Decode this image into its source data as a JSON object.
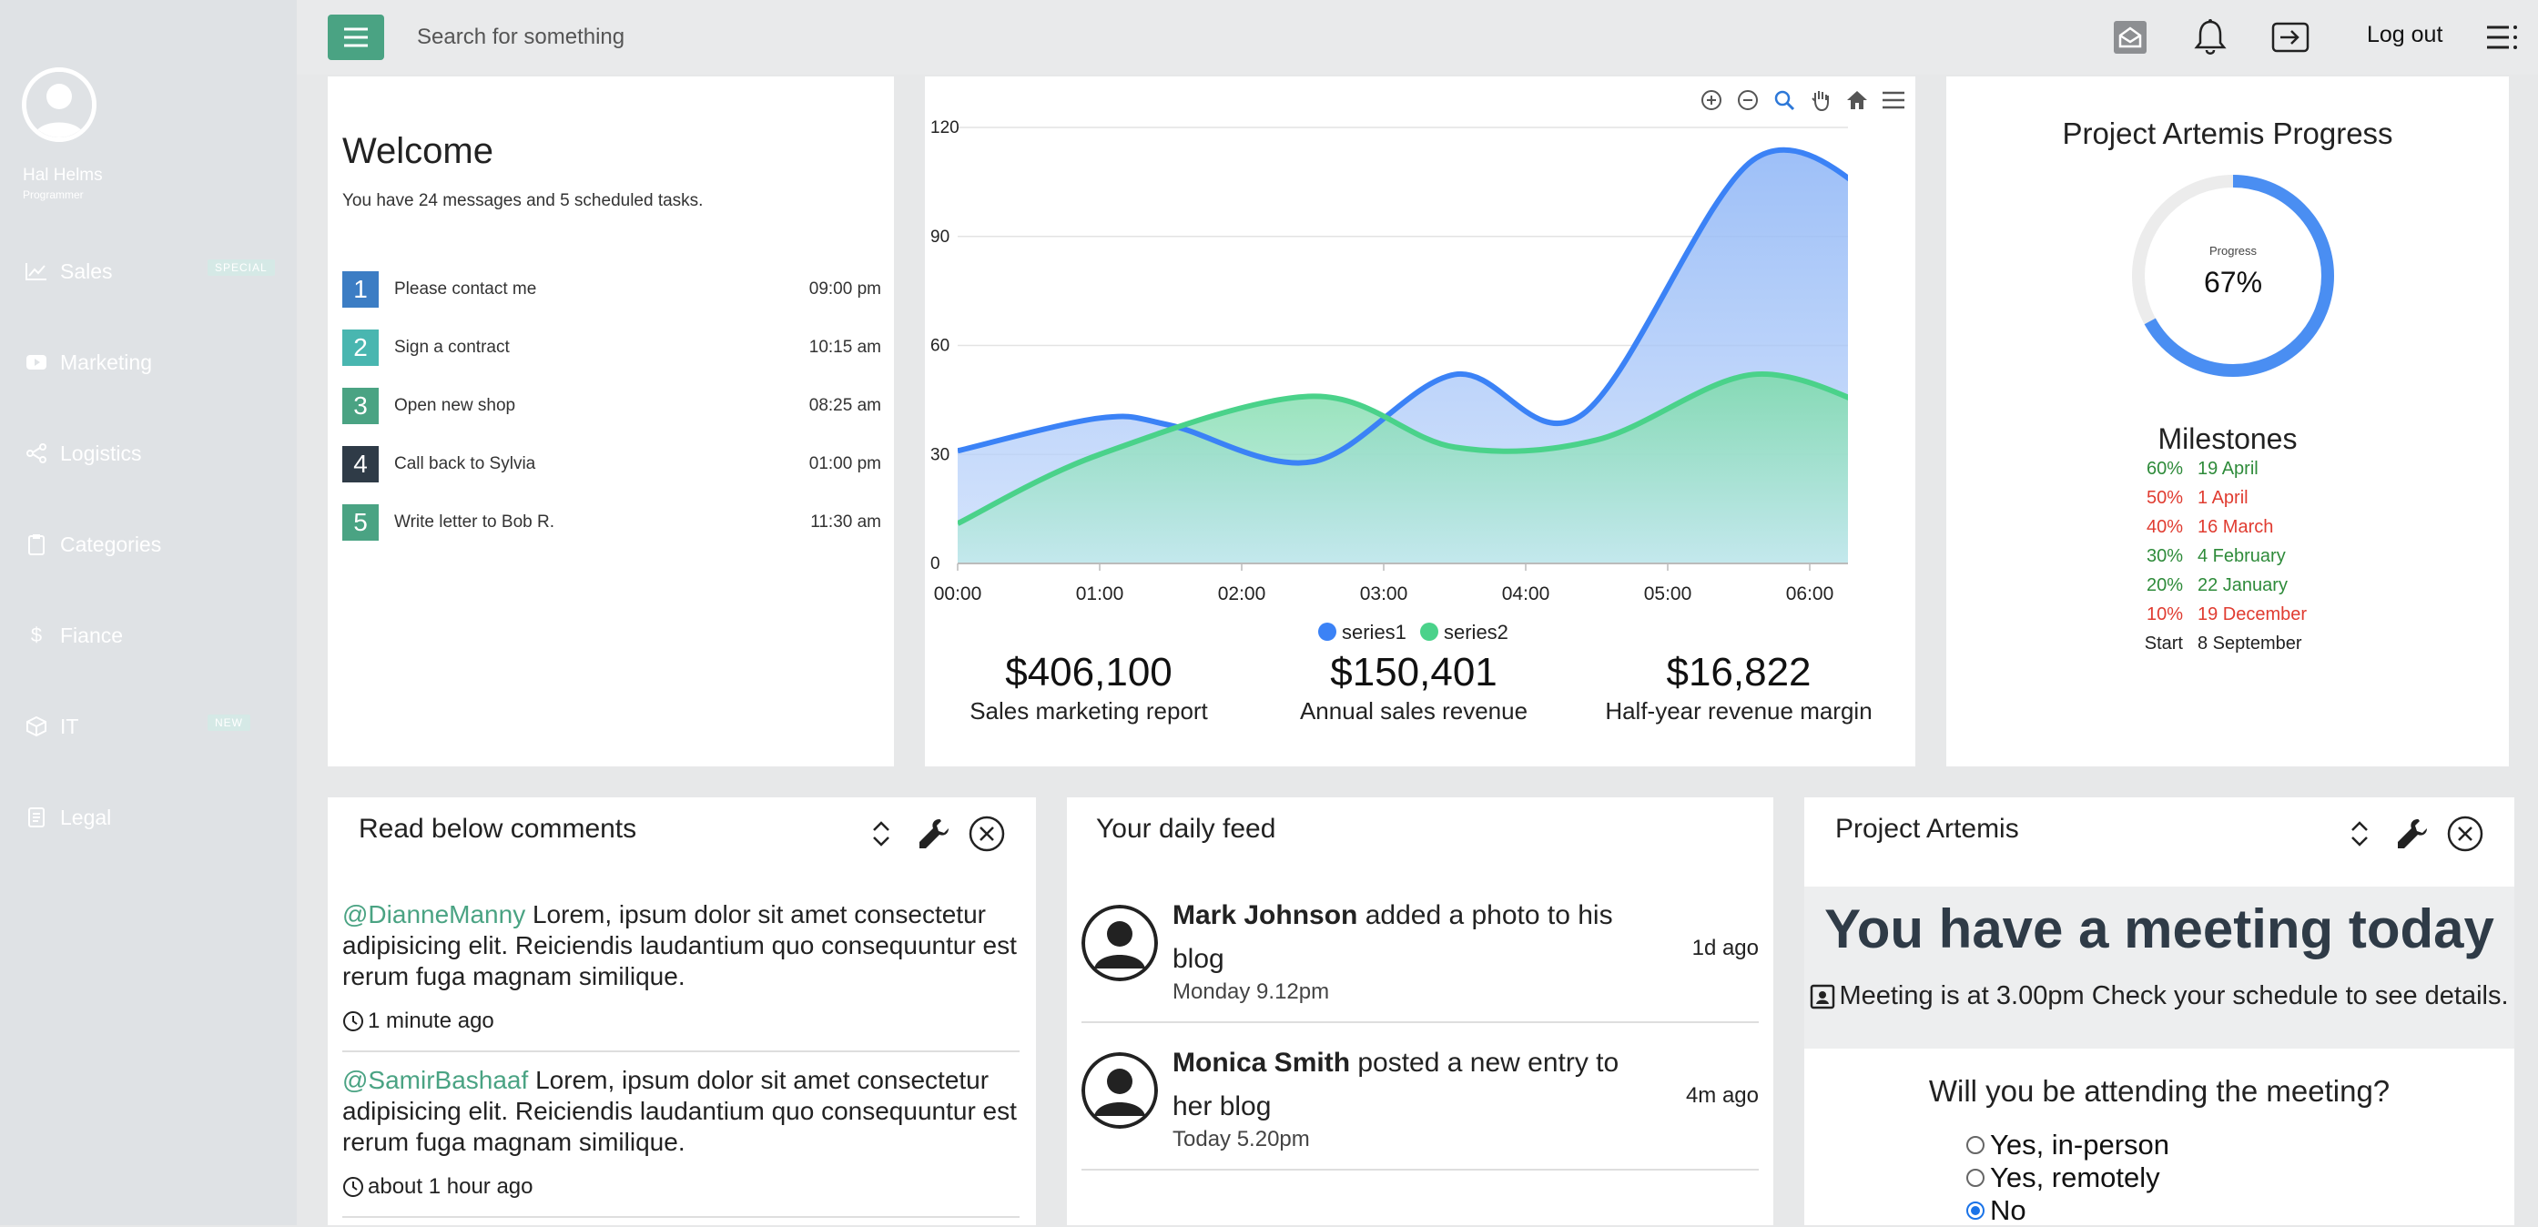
{
  "profile": {
    "name": "Hal Helms",
    "role": "Programmer"
  },
  "nav": [
    {
      "label": "Sales",
      "icon": "chart-line-icon",
      "badge": "SPECIAL"
    },
    {
      "label": "Marketing",
      "icon": "youtube-icon"
    },
    {
      "label": "Logistics",
      "icon": "share-icon"
    },
    {
      "label": "Categories",
      "icon": "clipboard-icon"
    },
    {
      "label": "Fiance",
      "icon": "dollar-icon"
    },
    {
      "label": "IT",
      "icon": "cube-icon",
      "badge": "NEW"
    },
    {
      "label": "Legal",
      "icon": "document-icon"
    }
  ],
  "topbar": {
    "search_placeholder": "Search for something",
    "logout_label": "Log out"
  },
  "welcome": {
    "title": "Welcome",
    "subtitle": "You have 24 messages and 5 scheduled tasks.",
    "tasks": [
      {
        "num": "1",
        "label": "Please contact me",
        "time": "09:00 pm",
        "color": "#3c7dc4"
      },
      {
        "num": "2",
        "label": "Sign a contract",
        "time": "10:15 am",
        "color": "#49b6b0"
      },
      {
        "num": "3",
        "label": "Open new shop",
        "time": "08:25 am",
        "color": "#4aa383"
      },
      {
        "num": "4",
        "label": "Call back to Sylvia",
        "time": "01:00 pm",
        "color": "#2f3b47"
      },
      {
        "num": "5",
        "label": "Write letter to Bob R.",
        "time": "11:30 am",
        "color": "#4aa383"
      }
    ]
  },
  "chart_data": {
    "type": "area",
    "x": [
      "00:00",
      "01:00",
      "02:00",
      "03:00",
      "04:00",
      "05:00",
      "06:00"
    ],
    "x_values": [
      0,
      1,
      2,
      3,
      4,
      5,
      6
    ],
    "series": [
      {
        "name": "series1",
        "color": "#3b82f6",
        "x": [
          0,
          1,
          1.5,
          2.5,
          3.5,
          4.4,
          5.6,
          6.5
        ],
        "values": [
          31,
          40,
          38,
          28,
          52,
          41,
          111,
          100
        ]
      },
      {
        "name": "series2",
        "color": "#4ad28a",
        "x": [
          0,
          1,
          2.5,
          3.5,
          4.5,
          5.6,
          6.5
        ],
        "values": [
          11,
          30,
          46,
          32,
          34,
          52,
          42
        ]
      }
    ],
    "ylim": [
      0,
      120
    ],
    "yticks": [
      0,
      30,
      60,
      90,
      120
    ],
    "xlim": [
      0,
      6.5
    ],
    "grid": true,
    "legend": "bottom"
  },
  "stats": [
    {
      "value": "$406,100",
      "label": "Sales marketing report"
    },
    {
      "value": "$150,401",
      "label": "Annual sales revenue"
    },
    {
      "value": "$16,822",
      "label": "Half-year revenue margin"
    }
  ],
  "progress": {
    "title": "Project Artemis Progress",
    "small_label": "Progress",
    "value_label": "67%",
    "value": 0.67,
    "milestones_title": "Milestones",
    "milestones": [
      {
        "pct": "60%",
        "date": "19 April",
        "color": "#2e8b3a"
      },
      {
        "pct": "50%",
        "date": "1 April",
        "color": "#e03c31"
      },
      {
        "pct": "40%",
        "date": "16 March",
        "color": "#e03c31"
      },
      {
        "pct": "30%",
        "date": "4 February",
        "color": "#2e8b3a"
      },
      {
        "pct": "20%",
        "date": "22 January",
        "color": "#2e8b3a"
      },
      {
        "pct": "10%",
        "date": "19 December",
        "color": "#e03c31"
      },
      {
        "pct": "Start",
        "date": "8 September",
        "color": "#222222"
      }
    ]
  },
  "comments_card": {
    "title": "Read below comments",
    "items": [
      {
        "mention": "@DianneManny",
        "text": " Lorem, ipsum dolor sit amet consectetur adipisicing elit. Reiciendis laudantium quo consequuntur est rerum fuga magnam similique.",
        "time": "1 minute ago"
      },
      {
        "mention": "@SamirBashaaf",
        "text": " Lorem, ipsum dolor sit amet consectetur adipisicing elit. Reiciendis laudantium quo consequuntur est rerum fuga magnam similique.",
        "time": "about 1 hour ago"
      }
    ]
  },
  "feed_card": {
    "title": "Your daily feed",
    "items": [
      {
        "name": "Mark Johnson",
        "action": " added a photo to his blog",
        "sub": "Monday 9.12pm",
        "ago": "1d ago"
      },
      {
        "name": "Monica Smith",
        "action": " posted a new entry to her blog",
        "sub": "Today 5.20pm",
        "ago": "4m ago"
      }
    ]
  },
  "artemis_card": {
    "title": "Project Artemis",
    "headline": "You have a meeting today",
    "note": "Meeting is at 3.00pm Check your schedule to see details.",
    "question": "Will you be attending the meeting?",
    "options": [
      {
        "label": "Yes, in-person",
        "checked": false
      },
      {
        "label": "Yes, remotely",
        "checked": false
      },
      {
        "label": "No",
        "checked": true
      }
    ]
  }
}
